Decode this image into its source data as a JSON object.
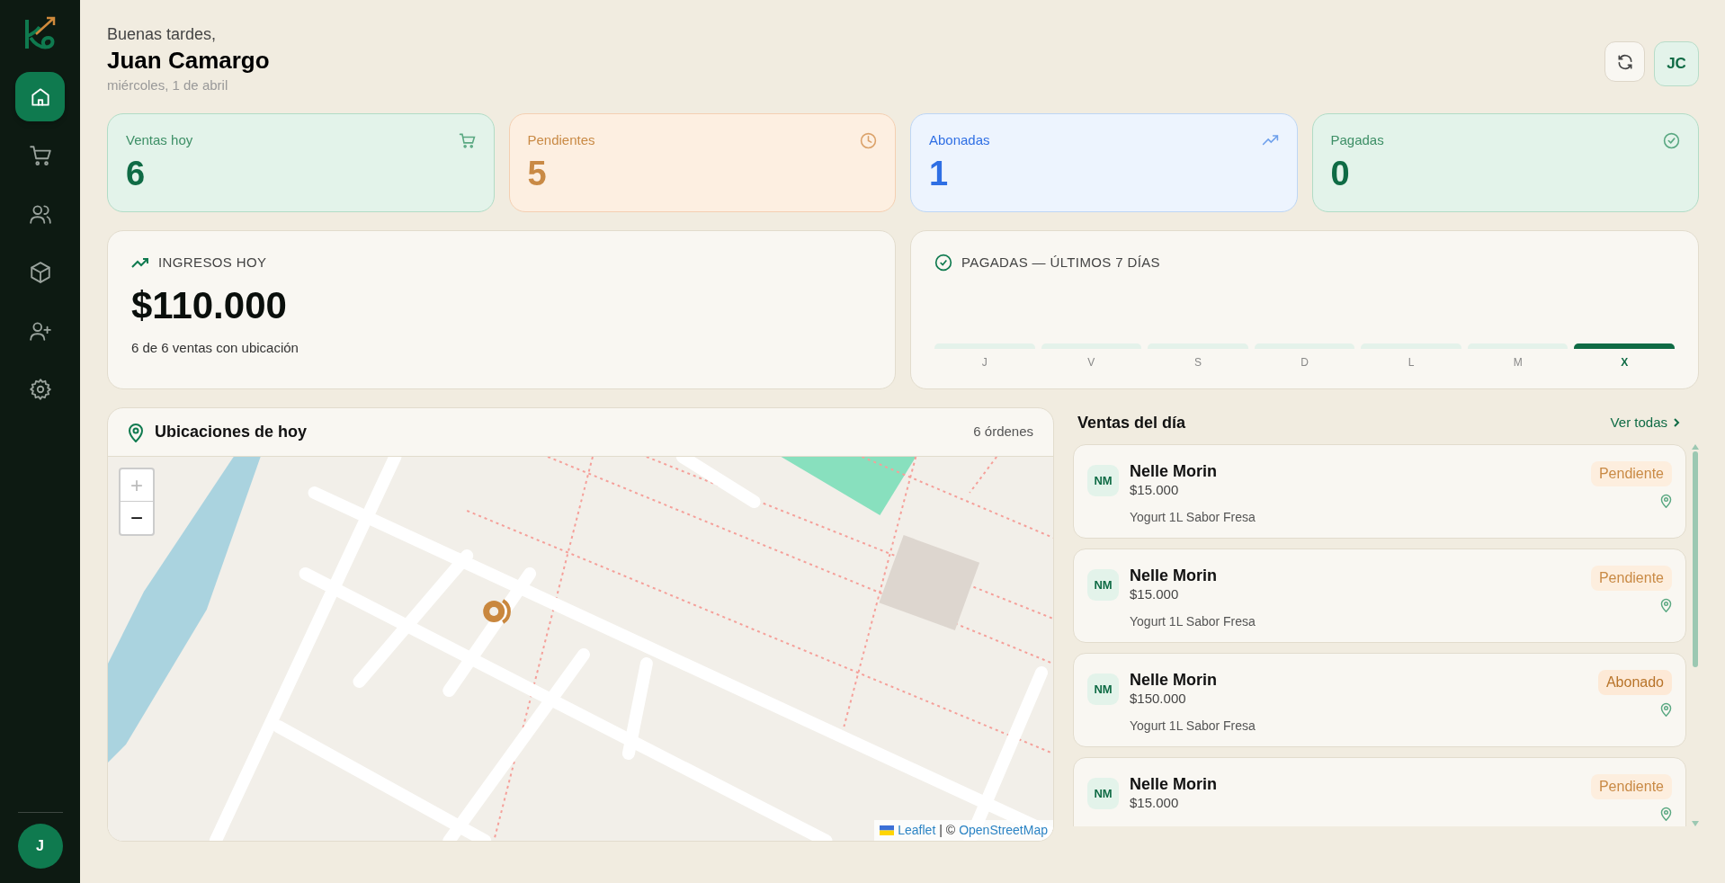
{
  "sidebar": {
    "items": [
      {
        "kind": "home",
        "selected": true
      },
      {
        "kind": "cart",
        "selected": false
      },
      {
        "kind": "users",
        "selected": false
      },
      {
        "kind": "box",
        "selected": false
      },
      {
        "kind": "adduser",
        "selected": false
      },
      {
        "kind": "settings",
        "selected": false
      }
    ],
    "user_initial": "J"
  },
  "header": {
    "greeting": "Buenas tardes,",
    "name": "Juan Camargo",
    "date": "miércoles, 1 de abril",
    "avatar": "JC"
  },
  "stats": [
    {
      "kind": "ventas",
      "label": "Ventas hoy",
      "value": "6"
    },
    {
      "kind": "pendientes",
      "label": "Pendientes",
      "value": "5"
    },
    {
      "kind": "abonadas",
      "label": "Abonadas",
      "value": "1"
    },
    {
      "kind": "pagadas",
      "label": "Pagadas",
      "value": "0"
    }
  ],
  "income": {
    "title": "INGRESOS HOY",
    "amount": "$110.000",
    "note": "6 de 6 ventas con ubicación"
  },
  "paid_chart": {
    "title": "PAGADAS — ÚLTIMOS 7 DÍAS",
    "days": [
      {
        "label": "J",
        "selected": false
      },
      {
        "label": "V",
        "selected": false
      },
      {
        "label": "S",
        "selected": false
      },
      {
        "label": "D",
        "selected": false
      },
      {
        "label": "L",
        "selected": false
      },
      {
        "label": "M",
        "selected": false
      },
      {
        "label": "X",
        "selected": true
      }
    ]
  },
  "map": {
    "title": "Ubicaciones de hoy",
    "count": "6 órdenes",
    "zoom_in": "+",
    "zoom_out": "−",
    "attribution_link": "Leaflet",
    "attribution_sep": "| ©",
    "attribution_source": "OpenStreetMap"
  },
  "sales": {
    "title": "Ventas del día",
    "view_all": "Ver todas",
    "items": [
      {
        "initials": "NM",
        "name": "Nelle Morin",
        "amount": "$15.000",
        "product": "Yogurt 1L Sabor Fresa",
        "status": "Pendiente",
        "kind": "pendiente"
      },
      {
        "initials": "NM",
        "name": "Nelle Morin",
        "amount": "$15.000",
        "product": "Yogurt 1L Sabor Fresa",
        "status": "Pendiente",
        "kind": "pendiente"
      },
      {
        "initials": "NM",
        "name": "Nelle Morin",
        "amount": "$150.000",
        "product": "Yogurt 1L Sabor Fresa",
        "status": "Abonado",
        "kind": "abonado"
      },
      {
        "initials": "NM",
        "name": "Nelle Morin",
        "amount": "$15.000",
        "status": "Pendiente",
        "kind": "pendiente"
      }
    ]
  }
}
